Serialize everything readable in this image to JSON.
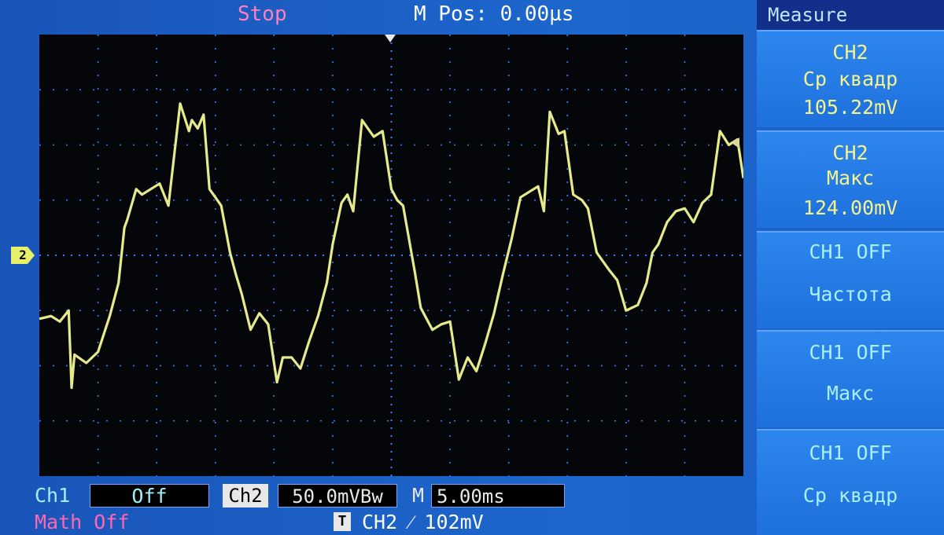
{
  "top_bar": {
    "run_state": "Stop",
    "horizontal_position": "M Pos: 0.00µs"
  },
  "channel_marker": "2",
  "measure_menu": {
    "title": "Measure",
    "items": [
      {
        "source": "CH2",
        "type": "Ср квадр",
        "value": "105.22mV"
      },
      {
        "source": "CH2",
        "type": "Макс",
        "value": "124.00mV"
      },
      {
        "source": "CH1  OFF",
        "type": "Частота"
      },
      {
        "source": "CH1  OFF",
        "type": "Макс"
      },
      {
        "source": "CH1  OFF",
        "type": "Ср  квадр"
      }
    ]
  },
  "status_bar": {
    "ch1_label": "Ch1",
    "ch1_value": "Off",
    "ch2_label": "Ch2",
    "ch2_scale": "50.0mVBw",
    "timebase_label": "M",
    "timebase_value": "5.00ms",
    "math_label": "Math Off",
    "trigger_icon": "T",
    "trigger_info": "CH2  ⁄  102mV"
  },
  "colors": {
    "trace": "#e6ea8a",
    "grid": "#3a7dff",
    "background": "#05060a",
    "frame": "#1d66cc"
  },
  "chart_data": {
    "type": "line",
    "grid_divisions": {
      "horizontal": 12,
      "vertical": 8
    },
    "series": [
      {
        "x": [
          0,
          0.2,
          0.35,
          0.5,
          0.55,
          0.6,
          0.8,
          1.0,
          1.2,
          1.35,
          1.45,
          1.5,
          1.65,
          1.75,
          1.9,
          2.05,
          2.2,
          2.4,
          2.55,
          2.6,
          2.7,
          2.8,
          2.9,
          3.0,
          3.1,
          3.25,
          3.35,
          3.45,
          3.6,
          3.75,
          3.9,
          4.05,
          4.15,
          4.3,
          4.45,
          4.6,
          4.75,
          4.9,
          5.0,
          5.15,
          5.25,
          5.35,
          5.5,
          5.7,
          5.85,
          6.0,
          6.1,
          6.2,
          6.4,
          6.5,
          6.6,
          6.7,
          6.85,
          7.0,
          7.15,
          7.3,
          7.45,
          7.6,
          7.75,
          7.9,
          8.05,
          8.2,
          8.35,
          8.5,
          8.6,
          8.7,
          8.85,
          8.95,
          9.1,
          9.25,
          9.35,
          9.5,
          9.7,
          9.85,
          10.0,
          10.2,
          10.35,
          10.45,
          10.55,
          10.7,
          10.85,
          11.0,
          11.15,
          11.3,
          11.45,
          11.6,
          11.75,
          11.9,
          12.0
        ],
        "y": [
          -1.15,
          -1.1,
          -1.2,
          -1.0,
          -2.4,
          -1.8,
          -1.95,
          -1.75,
          -1.1,
          -0.5,
          0.5,
          0.65,
          1.2,
          1.1,
          1.2,
          1.3,
          0.9,
          2.75,
          2.25,
          2.45,
          2.3,
          2.55,
          1.2,
          1.05,
          0.9,
          0.05,
          -0.35,
          -0.7,
          -1.35,
          -1.05,
          -1.25,
          -2.3,
          -1.85,
          -1.85,
          -2.05,
          -1.55,
          -1.1,
          -0.5,
          0.2,
          0.95,
          1.1,
          0.8,
          2.45,
          2.15,
          2.25,
          1.2,
          1.0,
          0.9,
          -0.3,
          -0.95,
          -1.15,
          -1.35,
          -1.25,
          -1.2,
          -2.25,
          -1.85,
          -2.1,
          -1.6,
          -1.05,
          -0.35,
          0.3,
          1.05,
          1.15,
          1.25,
          0.8,
          2.6,
          2.2,
          2.25,
          1.1,
          1.0,
          0.85,
          0.05,
          -0.25,
          -0.45,
          -1.0,
          -0.9,
          -0.5,
          0.05,
          0.2,
          0.6,
          0.8,
          0.85,
          0.6,
          0.95,
          1.1,
          2.25,
          2.0,
          2.1,
          1.4
        ]
      }
    ]
  }
}
